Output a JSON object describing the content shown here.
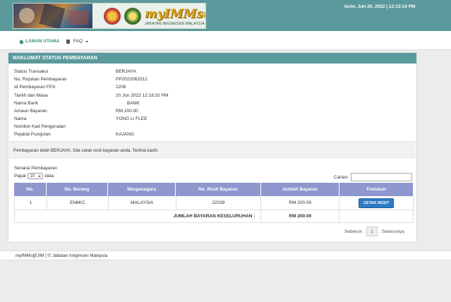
{
  "header": {
    "brand": "myIMMs@JIM",
    "subtitle": "JABATAN IMIGRESEN MALAYSIA",
    "datetime": "Isnin, Jun 20, 2022 | 12:13:14 PM",
    "accent_color": "#5b9a9c"
  },
  "nav": {
    "home_label": "LAMAN UTAMA",
    "faq_label": "FAQ"
  },
  "panel": {
    "title": "MAKLUMAT STATUS PEMBAYARAN",
    "details": [
      {
        "label": "Status Transaksi",
        "value": "BERJAYA"
      },
      {
        "label": "No. Rujukan Pembayaran",
        "value": "PP2022062012"
      },
      {
        "label": "Id Pembayaran FPX",
        "value": "2206"
      },
      {
        "label": "Tarikh dan Masa",
        "value": "20 Jun 2022 12:18:32 PM"
      },
      {
        "label": "Nama Bank",
        "value": "BANK"
      },
      {
        "label": "Amaun Bayaran",
        "value": "RM 200.00"
      },
      {
        "label": "Nama",
        "value": "YONG LI FLEE"
      },
      {
        "label": "Nombor Kad Pengenalan",
        "value": ""
      },
      {
        "label": "Pejabat Pungutan",
        "value": "KAJANG"
      }
    ],
    "notice": "Pembayaran telah BERJAYA. Sila cetak resit bayaran anda. Terima kasih."
  },
  "list": {
    "title": "Senarai Pembayaran",
    "show_prefix": "Papar",
    "page_size": "10",
    "show_suffix": "data",
    "search_label": "Carian:",
    "columns": [
      "No.",
      "No. Borang",
      "Warganegara",
      "No. Resit Bayaran",
      "Jumlah Bayaran",
      "Tindakan"
    ],
    "rows": [
      {
        "no": "1",
        "borang": "EN6KC",
        "warganegara": "MALAYSIA",
        "resit": "22039",
        "jumlah": "RM 200.00",
        "action": "CETAK RESIT"
      }
    ],
    "total_label": "JUMLAH BAYARAN KESELURUHAN :",
    "total_value": "RM 200.00"
  },
  "pager": {
    "prev": "Sebelum",
    "current": "1",
    "next": "Seterusnya"
  },
  "footer": {
    "text": "myIMMs@JIM | © Jabatan Imigresen Malaysia"
  }
}
